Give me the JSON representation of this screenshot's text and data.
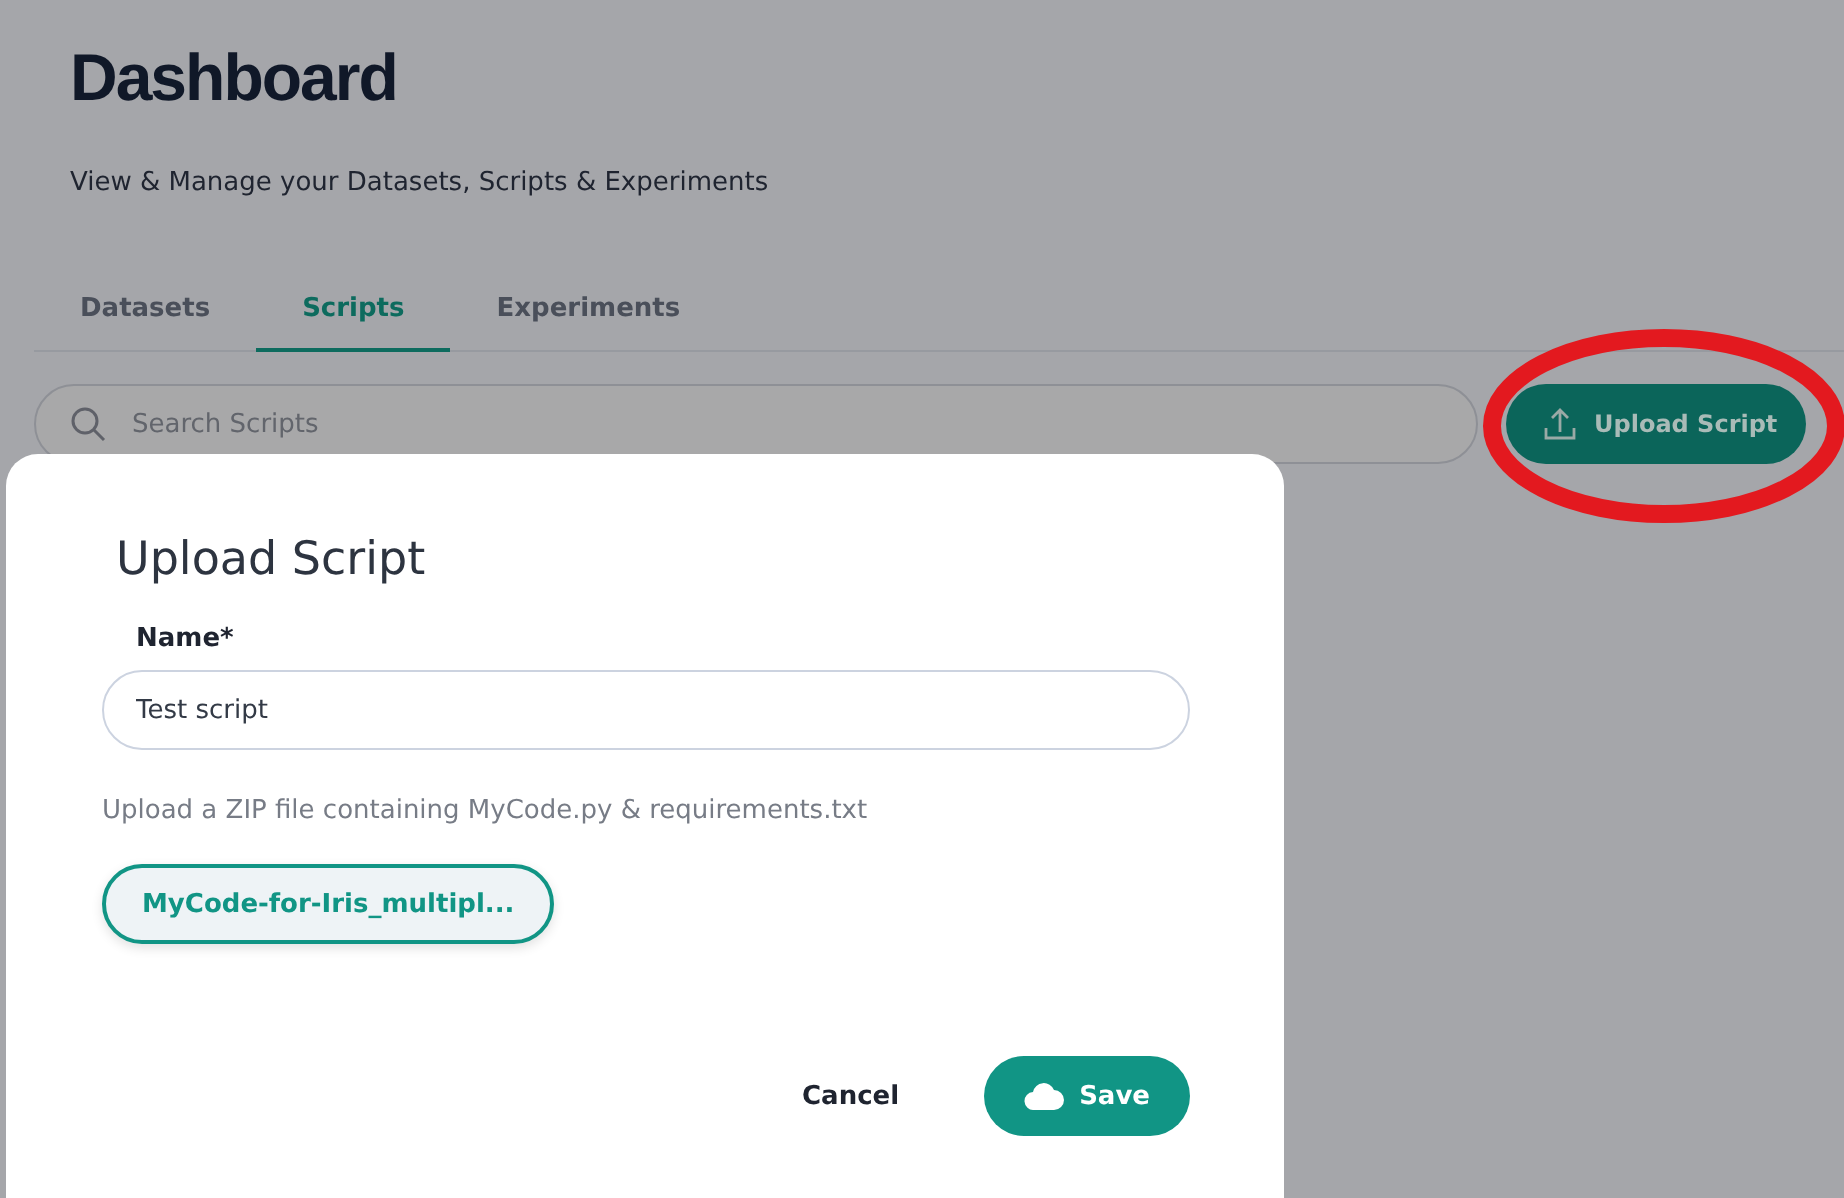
{
  "page": {
    "title": "Dashboard",
    "subtitle": "View & Manage your Datasets, Scripts & Experiments"
  },
  "tabs": [
    {
      "label": "Datasets",
      "selected": false
    },
    {
      "label": "Scripts",
      "selected": true
    },
    {
      "label": "Experiments",
      "selected": false
    }
  ],
  "search": {
    "placeholder": "Search Scripts"
  },
  "upload_button": {
    "label": "Upload Script"
  },
  "dialog": {
    "title": "Upload Script",
    "name_label": "Name*",
    "name_value": "Test script",
    "hint": "Upload a ZIP file containing MyCode.py & requirements.txt",
    "file_chip": "MyCode-for-Iris_multipl...",
    "cancel": "Cancel",
    "save": "Save"
  }
}
